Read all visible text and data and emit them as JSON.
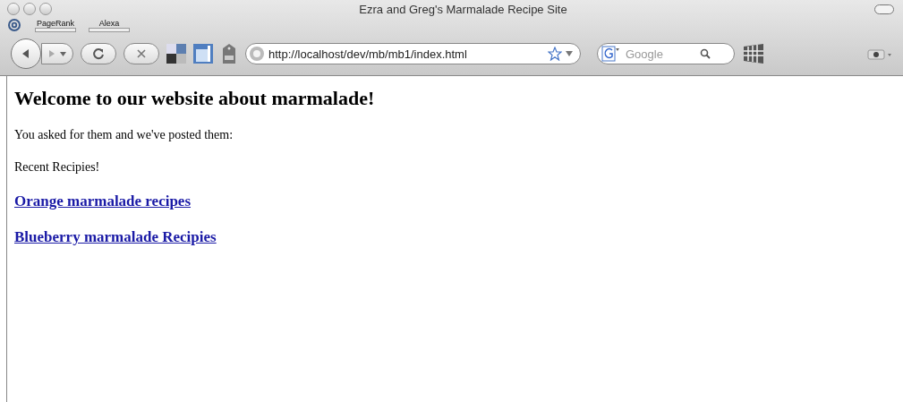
{
  "window": {
    "title": "Ezra and Greg's Marmalade Recipe Site"
  },
  "bookmarks": [
    {
      "label": "PageRank"
    },
    {
      "label": "Alexa"
    }
  ],
  "address_bar": {
    "value": "http://localhost/dev/mb/mb1/index.html"
  },
  "search": {
    "placeholder": "Google"
  },
  "page": {
    "heading": "Welcome to our website about marmalade!",
    "paragraphs": [
      "You asked for them and we've posted them:",
      "Recent Recipies!"
    ],
    "links": [
      "Orange marmalade recipes",
      "Blueberry marmalade Recipies"
    ]
  }
}
